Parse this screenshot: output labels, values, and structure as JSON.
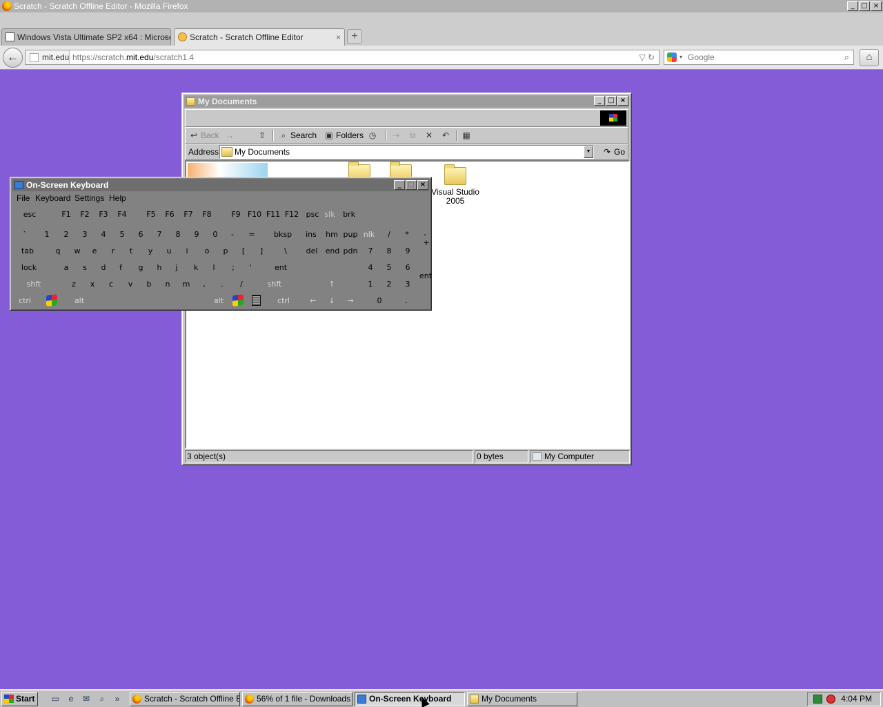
{
  "firefox": {
    "window_title": "Scratch - Scratch Offline Editor - Mozilla Firefox",
    "tabs": [
      {
        "label": "Windows Vista Ultimate SP2 x64 : Microso...",
        "close": "×",
        "active": false
      },
      {
        "label": "Scratch - Scratch Offline Editor",
        "close": "×",
        "active": true
      }
    ],
    "new_tab": "+",
    "identity": "mit.edu",
    "url_prefix": "https://scratch.",
    "url_host": "mit.edu",
    "url_path": "/scratch1.4",
    "url_buttons": "▽ ↻",
    "search_placeholder": "Google",
    "icons": {
      "back": "←",
      "search": "⌕",
      "home": "⌂",
      "dropdown": "▾"
    }
  },
  "explorer": {
    "title": "My Documents",
    "window_buttons": {
      "min": "_",
      "max": "□",
      "close": "×"
    },
    "toolbar": {
      "back": "Back",
      "forward": "→",
      "search": "Search",
      "folders": "Folders"
    },
    "address_label": "Address",
    "address_value": "My Documents",
    "address_dropdown": "▼",
    "go_label": "Go",
    "items": [
      {
        "label": "Visual Studio 2005"
      }
    ],
    "status": {
      "objects": "3 object(s)",
      "size": "0 bytes",
      "zone": "My Computer"
    }
  },
  "osk": {
    "title": "On-Screen Keyboard",
    "window_buttons": {
      "min": "_",
      "max": "□",
      "close": "×"
    },
    "menu": [
      "File",
      "Keyboard",
      "Settings",
      "Help"
    ],
    "rows": {
      "fn": [
        "esc",
        "F1",
        "F2",
        "F3",
        "F4",
        "F5",
        "F6",
        "F7",
        "F8",
        "F9",
        "F10",
        "F11",
        "F12",
        "psc",
        "slk",
        "brk"
      ],
      "num": [
        "`",
        "1",
        "2",
        "3",
        "4",
        "5",
        "6",
        "7",
        "8",
        "9",
        "0",
        "-",
        "=",
        "bksp",
        "ins",
        "hm",
        "pup",
        "nlk",
        "/",
        "*",
        "-"
      ],
      "top": [
        "tab",
        "q",
        "w",
        "e",
        "r",
        "t",
        "y",
        "u",
        "i",
        "o",
        "p",
        "[",
        "]",
        "\\",
        "del",
        "end",
        "pdn",
        "7",
        "8",
        "9",
        "+"
      ],
      "home": [
        "lock",
        "a",
        "s",
        "d",
        "f",
        "g",
        "h",
        "j",
        "k",
        "l",
        ";",
        "'",
        "ent",
        "4",
        "5",
        "6"
      ],
      "shift": [
        "shft",
        "z",
        "x",
        "c",
        "v",
        "b",
        "n",
        "m",
        ",",
        ".",
        "/",
        "shft",
        "↑",
        "1",
        "2",
        "3",
        "ent"
      ],
      "bottom": [
        "ctrl",
        "alt",
        "alt",
        "ctrl",
        "←",
        "↓",
        "→",
        "0",
        "."
      ]
    }
  },
  "taskbar": {
    "start": "Start",
    "quicklaunch_more": "»",
    "buttons": [
      {
        "label": "Scratch - Scratch Offline E...",
        "active": false
      },
      {
        "label": "56% of 1 file - Downloads",
        "active": false
      },
      {
        "label": "On-Screen Keyboard",
        "active": true
      },
      {
        "label": "My Documents",
        "active": false
      }
    ],
    "clock": "4:04 PM"
  }
}
